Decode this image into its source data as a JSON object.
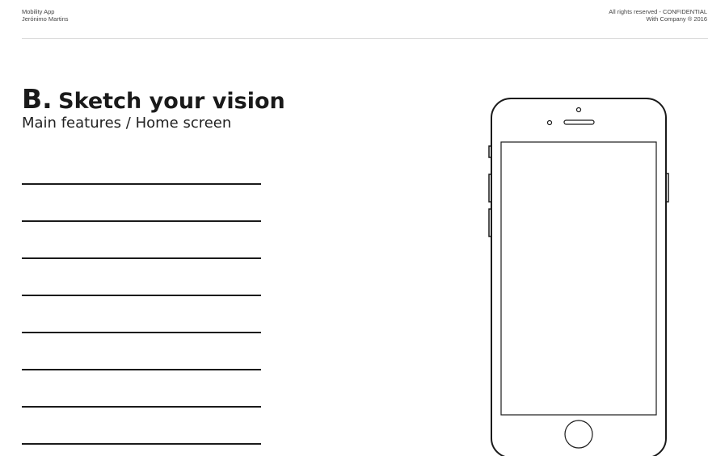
{
  "header": {
    "left_line1": "Mobility App",
    "left_line2": "Jerónimo Martins",
    "right_line1": "All rights reserved - CONFIDENTIAL",
    "right_line2": "With Company ® 2016"
  },
  "section": {
    "letter": "B.",
    "title": "Sketch your vision",
    "subtitle": "Main features / Home screen"
  },
  "colors": {
    "ink": "#1a1a1a",
    "rule": "#d9d9d9",
    "background": "#ffffff"
  },
  "icons": {
    "phone_outline": "smartphone-outline-icon"
  }
}
